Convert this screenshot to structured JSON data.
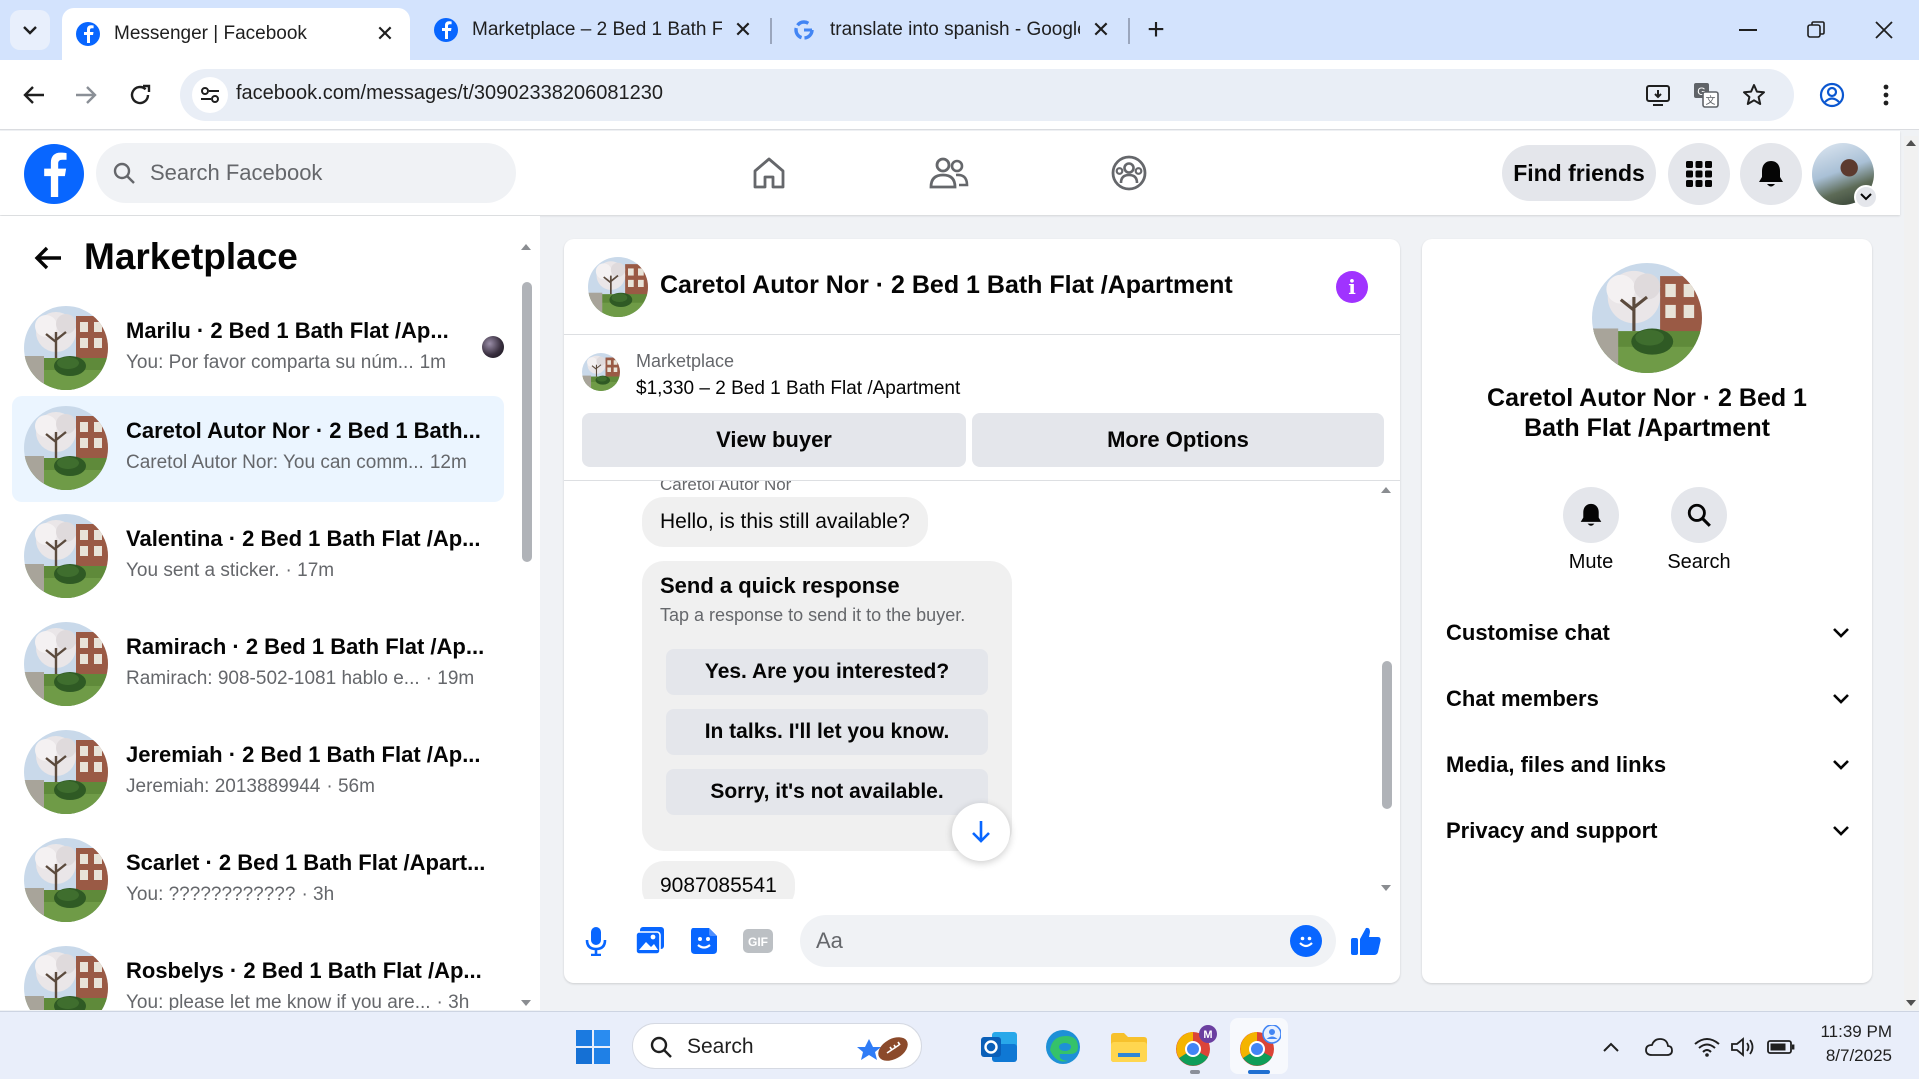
{
  "browser": {
    "tabs": [
      {
        "title": "Messenger | Facebook",
        "active": true
      },
      {
        "title": "Marketplace – 2 Bed 1 Bath Flat",
        "active": false
      },
      {
        "title": "translate into spanish - Google",
        "active": false
      }
    ],
    "url": "facebook.com/messages/t/30902338206081230"
  },
  "fb": {
    "search_placeholder": "Search Facebook",
    "find_friends": "Find friends",
    "brand_color": "#0866ff"
  },
  "left": {
    "title": "Marketplace",
    "conversations": [
      {
        "name": "Marilu · 2 Bed 1 Bath Flat /Ap...",
        "snippet": "You: Por favor comparta su núm...",
        "time": "1m"
      },
      {
        "name": "Caretol Autor Nor · 2 Bed 1 Bath...",
        "snippet": "Caretol Autor Nor: You can comm...",
        "time": "12m"
      },
      {
        "name": "Valentina · 2 Bed 1 Bath Flat /Ap...",
        "snippet": "You sent a sticker.",
        "time": "· 17m"
      },
      {
        "name": "Ramirach · 2 Bed 1 Bath Flat /Ap...",
        "snippet": "Ramirach: 908-502-1081 hablo e...",
        "time": "· 19m"
      },
      {
        "name": "Jeremiah · 2 Bed 1 Bath Flat /Ap...",
        "snippet": "Jeremiah: 2013889944",
        "time": "· 56m"
      },
      {
        "name": "Scarlet · 2 Bed 1 Bath Flat /Apart...",
        "snippet": "You: ????????????",
        "time": "· 3h"
      },
      {
        "name": "Rosbelys · 2 Bed 1 Bath Flat /Ap...",
        "snippet": "You: please let me know if you are...",
        "time": "· 3h"
      }
    ]
  },
  "chat": {
    "title": "Caretol Autor Nor · 2 Bed 1 Bath Flat /Apartment",
    "listing_kind": "Marketplace",
    "listing_price": "$1,330 – 2 Bed 1 Bath Flat /Apartment",
    "view_buyer": "View buyer",
    "more_options": "More Options",
    "sender": "Caretol Autor Nor",
    "message_1": "Hello, is this still available?",
    "quick_title": "Send a quick response",
    "quick_sub": "Tap a response to send it to the buyer.",
    "quick_responses": [
      "Yes. Are you interested?",
      "In talks. I'll let you know.",
      "Sorry, it's not available."
    ],
    "message_2": "9087085541",
    "composer_placeholder": "Aa"
  },
  "details": {
    "name": "Caretol Autor Nor · 2 Bed 1 Bath Flat /Apartment",
    "mute": "Mute",
    "search": "Search",
    "sections": [
      "Customise chat",
      "Chat members",
      "Media, files and links",
      "Privacy and support"
    ]
  },
  "taskbar": {
    "search_label": "Search",
    "time": "11:39 PM",
    "date": "8/7/2025"
  }
}
